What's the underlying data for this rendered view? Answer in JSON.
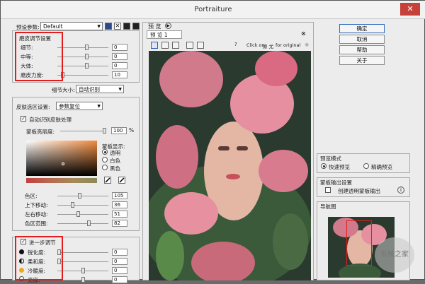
{
  "window": {
    "title": "Portraiture",
    "close": "✕"
  },
  "preset": {
    "label": "预设参数:",
    "value": "Default"
  },
  "smooth": {
    "title": "磨皮调节设置",
    "rows": [
      {
        "label": "细节:",
        "value": "0",
        "pos": 0.58
      },
      {
        "label": "中等:",
        "value": "0",
        "pos": 0.58
      },
      {
        "label": "大体:",
        "value": "0",
        "pos": 0.58
      },
      {
        "label": "磨皮力度:",
        "value": "10",
        "pos": 0.08
      }
    ],
    "size_label": "细节大小:",
    "size_value": "自动识别"
  },
  "skin": {
    "label": "皮肤选区设置:",
    "value": "参数复位",
    "auto_label": "自动识别皮肤处理",
    "opacity_label": "蒙板亮丽度:",
    "opacity_value": "100",
    "opacity_unit": "%",
    "mask_label": "蒙板显示:",
    "mask_opts": [
      "透明",
      "白色",
      "黑色"
    ],
    "rows": [
      {
        "label": "色区:",
        "value": "105",
        "pos": 0.44
      },
      {
        "label": "上下移动:",
        "value": "36",
        "pos": 0.28
      },
      {
        "label": "左右移动:",
        "value": "51",
        "pos": 0.4
      },
      {
        "label": "色区范围:",
        "value": "82",
        "pos": 0.62
      }
    ]
  },
  "enhance": {
    "title": "进一步调节",
    "rows": [
      {
        "label": "锐化度:",
        "value": "0",
        "pos": 0.0
      },
      {
        "label": "柔和度:",
        "value": "0",
        "pos": 0.0
      },
      {
        "label": "冷暖度:",
        "value": "0",
        "pos": 0.5
      },
      {
        "label": "亮度:",
        "value": "0",
        "pos": 0.5
      }
    ]
  },
  "preview": {
    "tab_header": "预 览",
    "tab": "预 览 1",
    "hint_pre": "Click on",
    "hint_mid": "原 尤",
    "hint_post": "for original",
    "add": "+"
  },
  "buttons": {
    "ok": "确定",
    "cancel": "取消",
    "help": "帮助",
    "about": "关于"
  },
  "mode": {
    "title": "预览模式",
    "opt1": "快速预览",
    "opt2": "精确预览"
  },
  "output": {
    "title": "蒙板输出设置",
    "opt": "创建透明蒙板输出",
    "info": "i"
  },
  "nav": {
    "title": "导航图"
  },
  "watermark": "系统之家"
}
